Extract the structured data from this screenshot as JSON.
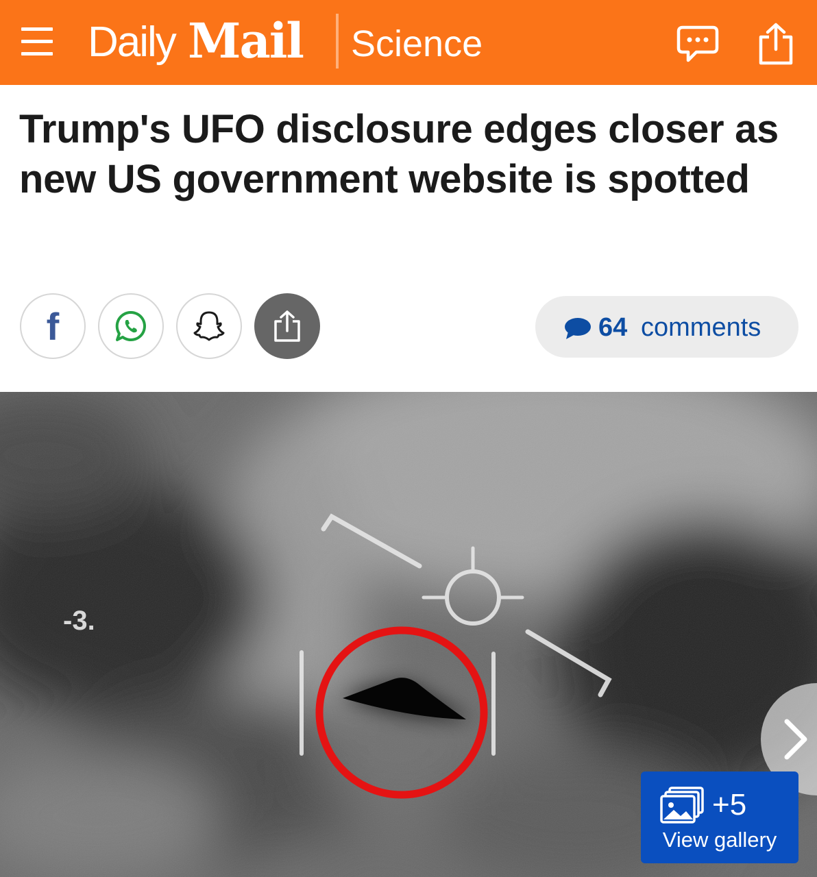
{
  "header": {
    "brand_daily": "Daily",
    "brand_mail": "Mail",
    "section": "Science",
    "accent_color": "#fb7418"
  },
  "article": {
    "headline": "Trump's UFO disclosure edges closer as new US government website is spotted"
  },
  "share": {
    "facebook_glyph": "f",
    "icons": [
      "facebook-icon",
      "whatsapp-icon",
      "snapchat-icon",
      "share-icon"
    ]
  },
  "comments": {
    "count": "64",
    "label": "comments",
    "color": "#0d4da3"
  },
  "hero": {
    "hud_text": "-3.",
    "gallery_count": "+5",
    "gallery_label": "View gallery",
    "gallery_color": "#0a4fbf"
  }
}
